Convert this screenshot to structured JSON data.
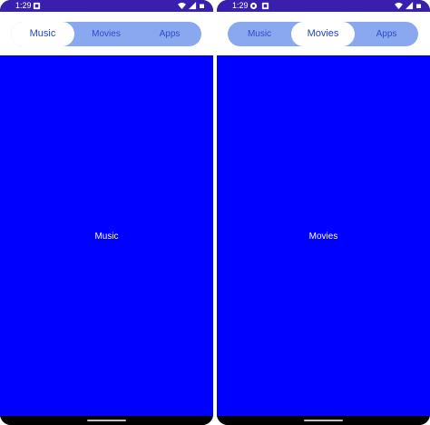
{
  "phones": [
    {
      "status": {
        "time": "1:29",
        "left_icons": [
          "notification-icon"
        ],
        "right_icons": [
          "wifi-icon",
          "signal-icon",
          "battery-icon"
        ]
      },
      "tabs": {
        "options": [
          "Music",
          "Movies",
          "Apps"
        ],
        "selected": "Music"
      },
      "content": {
        "label": "Music"
      }
    },
    {
      "status": {
        "time": "1:29",
        "left_icons": [
          "gear-icon",
          "notification-icon"
        ],
        "right_icons": [
          "wifi-icon",
          "signal-icon",
          "battery-icon"
        ]
      },
      "tabs": {
        "options": [
          "Music",
          "Movies",
          "Apps"
        ],
        "selected": "Movies"
      },
      "content": {
        "label": "Movies"
      }
    }
  ],
  "colors": {
    "status_bar": "#3a1fae",
    "segmented_track": "#8aa8f0",
    "segment_selected": "#ffffff",
    "segment_text": "#2f4cc4",
    "content_background": "#0000ff",
    "content_text": "#ffffff"
  }
}
